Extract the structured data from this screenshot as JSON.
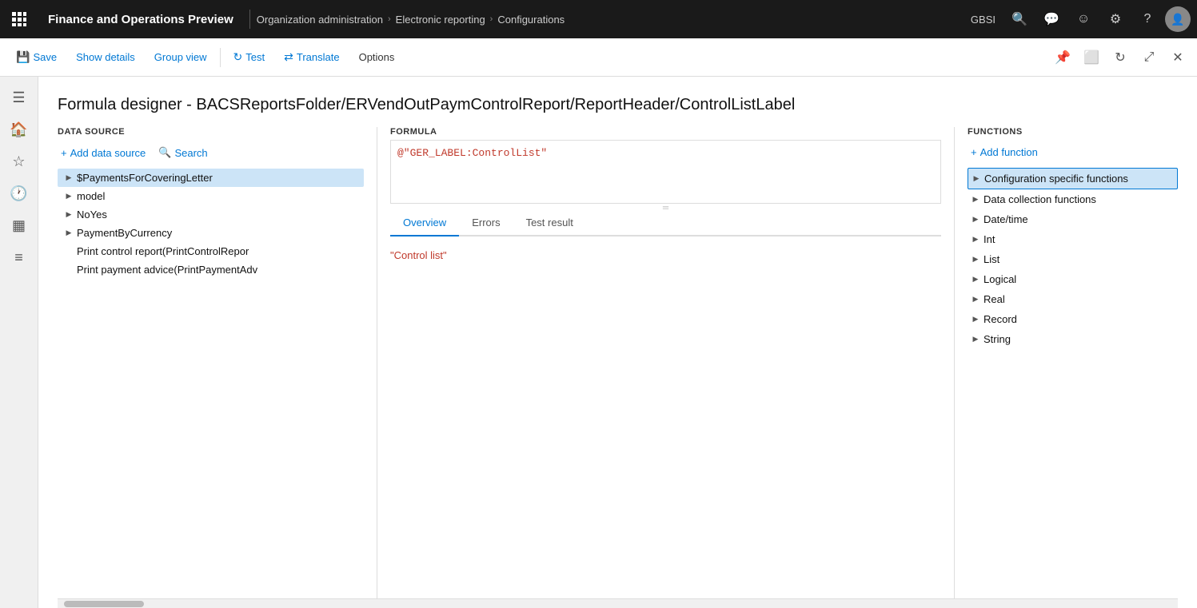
{
  "app": {
    "title": "Finance and Operations Preview"
  },
  "topbar": {
    "breadcrumb": [
      "Organization administration",
      "Electronic reporting",
      "Configurations"
    ],
    "org_code": "GBSI"
  },
  "toolbar": {
    "save_label": "Save",
    "show_details_label": "Show details",
    "group_view_label": "Group view",
    "test_label": "Test",
    "translate_label": "Translate",
    "options_label": "Options"
  },
  "page": {
    "title": "Formula designer - BACSReportsFolder/ERVendOutPaymControlReport/ReportHeader/ControlListLabel"
  },
  "datasource": {
    "header": "DATA SOURCE",
    "add_btn": "Add data source",
    "search_btn": "Search",
    "items": [
      {
        "id": "payments",
        "label": "$PaymentsForCoveringLetter",
        "has_children": true,
        "selected": true,
        "indent": 0
      },
      {
        "id": "model",
        "label": "model",
        "has_children": true,
        "selected": false,
        "indent": 0
      },
      {
        "id": "noyes",
        "label": "NoYes",
        "has_children": true,
        "selected": false,
        "indent": 0
      },
      {
        "id": "paybycurrency",
        "label": "PaymentByCurrency",
        "has_children": true,
        "selected": false,
        "indent": 0
      },
      {
        "id": "printcontrol",
        "label": "Print control report(PrintControlRepor",
        "has_children": false,
        "selected": false,
        "indent": 0
      },
      {
        "id": "printpayment",
        "label": "Print payment advice(PrintPaymentAdv",
        "has_children": false,
        "selected": false,
        "indent": 0
      }
    ]
  },
  "formula": {
    "label": "FORMULA",
    "code": "@\"GER_LABEL:ControlList\""
  },
  "tabs": {
    "items": [
      "Overview",
      "Errors",
      "Test result"
    ],
    "active": "Overview"
  },
  "overview": {
    "value": "\"Control list\""
  },
  "functions": {
    "header": "FUNCTIONS",
    "add_btn": "Add function",
    "items": [
      {
        "id": "config",
        "label": "Configuration specific functions",
        "selected": true
      },
      {
        "id": "datacoll",
        "label": "Data collection functions",
        "selected": false
      },
      {
        "id": "datetime",
        "label": "Date/time",
        "selected": false
      },
      {
        "id": "int",
        "label": "Int",
        "selected": false
      },
      {
        "id": "list",
        "label": "List",
        "selected": false
      },
      {
        "id": "logical",
        "label": "Logical",
        "selected": false
      },
      {
        "id": "real",
        "label": "Real",
        "selected": false
      },
      {
        "id": "record",
        "label": "Record",
        "selected": false
      },
      {
        "id": "string",
        "label": "String",
        "selected": false
      }
    ]
  },
  "left_nav": {
    "items": [
      "home",
      "star",
      "clock",
      "table",
      "list"
    ]
  }
}
